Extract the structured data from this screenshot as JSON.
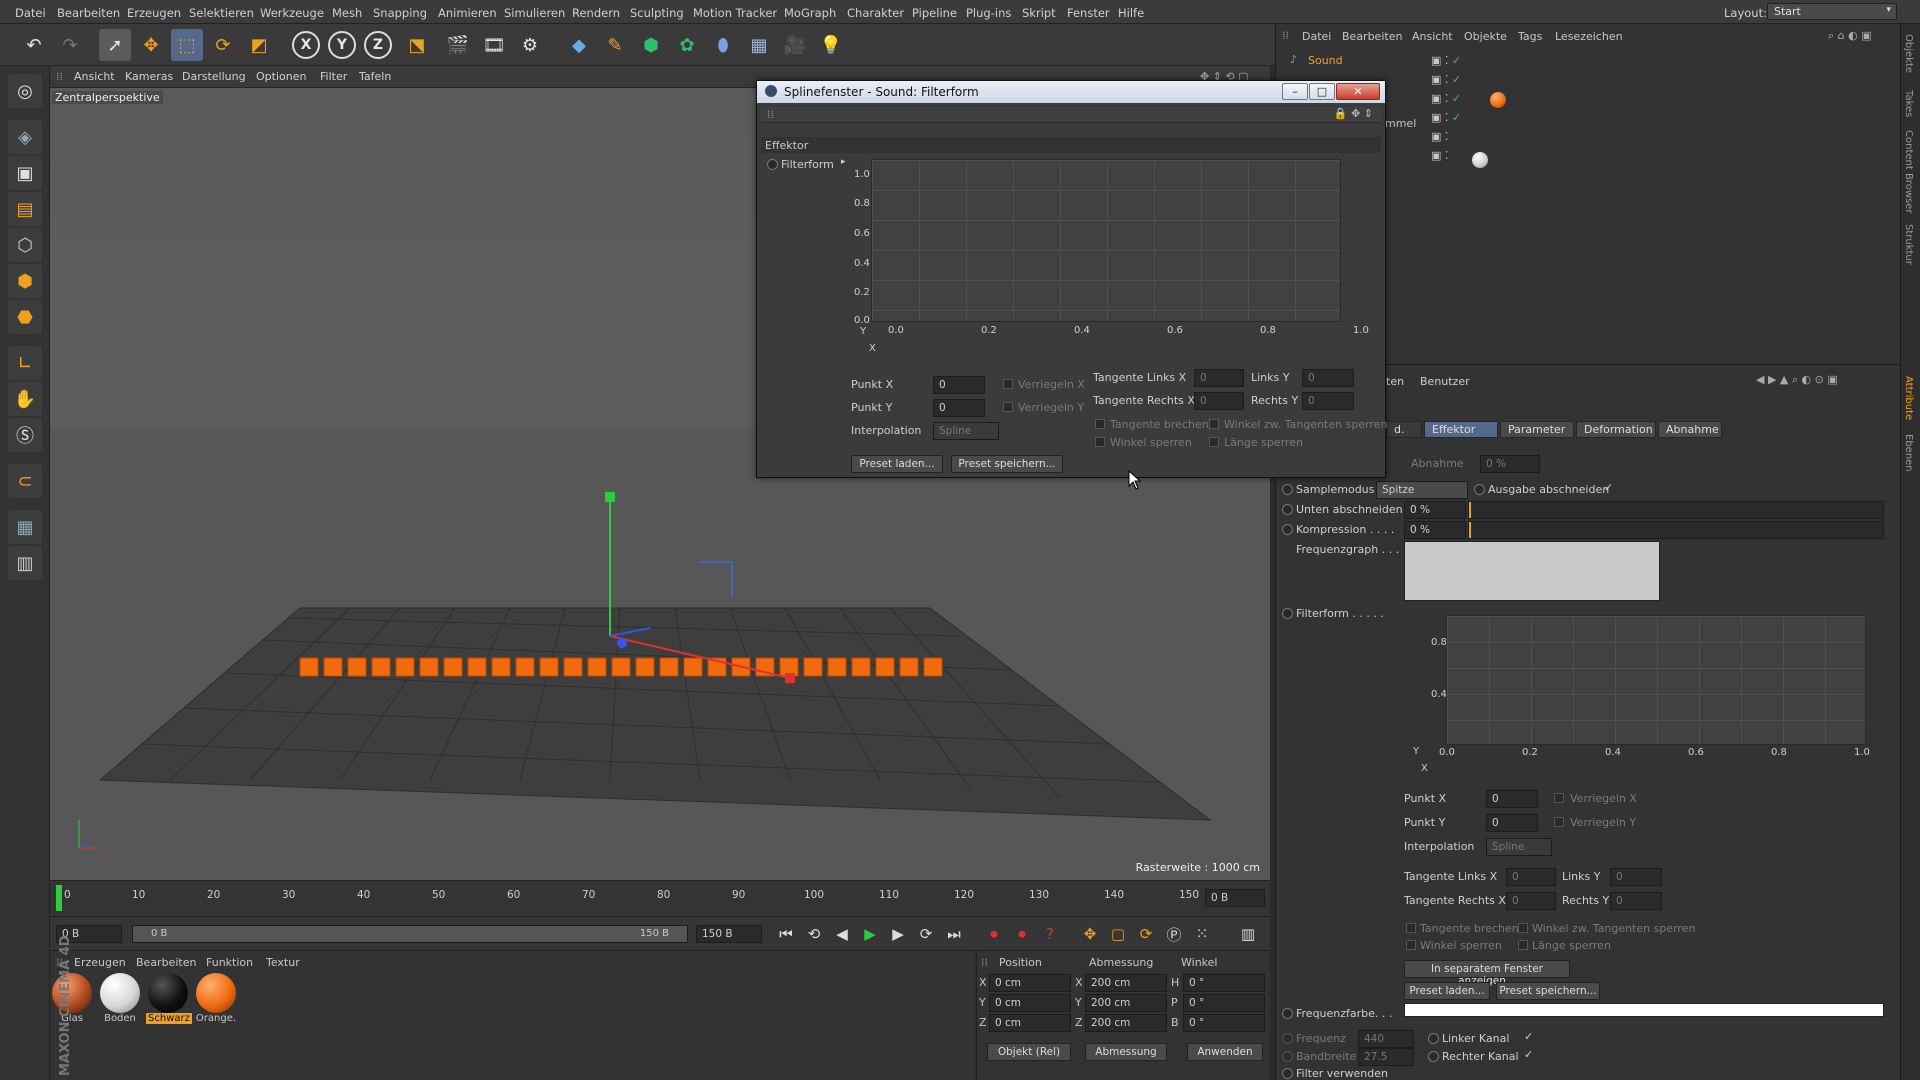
{
  "menu": [
    "Datei",
    "Bearbeiten",
    "Erzeugen",
    "Selektieren",
    "Werkzeuge",
    "Mesh",
    "Snapping",
    "Animieren",
    "Simulieren",
    "Rendern",
    "Sculpting",
    "Motion Tracker",
    "MoGraph",
    "Charakter",
    "Pipeline",
    "Plug-ins",
    "Skript",
    "Fenster",
    "Hilfe"
  ],
  "layout": {
    "label": "Layout:",
    "value": "Start"
  },
  "viewport": {
    "menu": [
      "Ansicht",
      "Kameras",
      "Darstellung",
      "Optionen",
      "Filter",
      "Tafeln"
    ],
    "camera_label": "Zentralperspektive",
    "grid_label": "Rasterweite : 1000 cm"
  },
  "timeline": {
    "ticks": [
      "0",
      "10",
      "20",
      "30",
      "40",
      "50",
      "60",
      "70",
      "80",
      "90",
      "100",
      "110",
      "120",
      "130",
      "140",
      "150"
    ],
    "frame_end": "0 B",
    "cur_frame": "0 B",
    "range_start": "0 B",
    "range_end": "150 B",
    "max_frame": "150 B"
  },
  "materials": {
    "menu": [
      "Erzeugen",
      "Bearbeiten",
      "Funktion",
      "Textur"
    ],
    "items": [
      {
        "name": "Glas",
        "color": "#b04a20"
      },
      {
        "name": "Boden",
        "color": "#e6e6e6"
      },
      {
        "name": "Schwarz",
        "color": "#151515"
      },
      {
        "name": "Orange.",
        "color": "#f06a10"
      }
    ],
    "brand": "MAXON CINEMA 4D"
  },
  "coords": {
    "headers": [
      "Position",
      "Abmessung",
      "Winkel"
    ],
    "rows": [
      {
        "a": "X",
        "pos": "0 cm",
        "b": "X",
        "size": "200 cm",
        "c": "H",
        "rot": "0 °"
      },
      {
        "a": "Y",
        "pos": "0 cm",
        "b": "Y",
        "size": "200 cm",
        "c": "P",
        "rot": "0 °"
      },
      {
        "a": "Z",
        "pos": "0 cm",
        "b": "Z",
        "size": "200 cm",
        "c": "B",
        "rot": "0 °"
      }
    ],
    "mode": "Objekt (Rel)",
    "size_mode": "Abmessung",
    "apply": "Anwenden"
  },
  "objects": {
    "menu": [
      "Datei",
      "Bearbeiten",
      "Ansicht",
      "Objekte",
      "Tags",
      "Lesezeichen"
    ],
    "first": "Sound",
    "partial": "mmel"
  },
  "attributes": {
    "partial_tab": "ten",
    "user": "Benutzer",
    "tabs": [
      "d.",
      "Effektor",
      "Parameter",
      "Deformation",
      "Abnahme"
    ],
    "abnahme": {
      "label": "Abnahme",
      "value": "0 %"
    },
    "samplemodus": {
      "label": "Samplemodus",
      "value": "Spitze"
    },
    "ausgabe": "Ausgabe abschneiden",
    "unten": {
      "label": "Unten abschneiden",
      "value": "0 %"
    },
    "kompression": {
      "label": "Kompression . . . .",
      "value": "0 %"
    },
    "frequenzgraph": "Frequenzgraph . . .",
    "filterform": "Filterform . . . . .",
    "graph_y": [
      "0.8",
      "0.4"
    ],
    "graph_x": [
      "0.0",
      "0.2",
      "0.4",
      "0.6",
      "0.8",
      "1.0"
    ],
    "y": "Y",
    "x": "X",
    "punkt_x": {
      "label": "Punkt X",
      "value": "0"
    },
    "punkt_y": {
      "label": "Punkt Y",
      "value": "0"
    },
    "verriegeln_x": "Verriegeln X",
    "verriegeln_y": "Verriegeln Y",
    "interpolation": {
      "label": "Interpolation",
      "value": "Spline"
    },
    "tan_links_x": {
      "label": "Tangente Links X",
      "value": "0"
    },
    "links_y": {
      "label": "Links Y",
      "value": "0"
    },
    "tan_rechts_x": {
      "label": "Tangente Rechts X",
      "value": "0"
    },
    "rechts_y": {
      "label": "Rechts Y",
      "value": "0"
    },
    "tangente_brechen": "Tangente brechen",
    "winkel_zw": "Winkel zw. Tangenten sperren",
    "winkel_sperren": "Winkel sperren",
    "laenge_sperren": "Länge sperren",
    "separate": "In separatem Fenster anzeigen...",
    "preset_load": "Preset laden...",
    "preset_save": "Preset speichern...",
    "frequenzfarbe": "Frequenzfarbe. . .",
    "frequenz": {
      "label": "Frequenz",
      "value": "440"
    },
    "bandbreite": {
      "label": "Bandbreite",
      "value": "27.5"
    },
    "linker": "Linker Kanal",
    "rechter": "Rechter Kanal",
    "filter": "Filter verwenden"
  },
  "dialog": {
    "title": "Splinefenster - Sound: Filterform",
    "section": "Effektor",
    "item": "Filterform",
    "y_ticks": [
      "1.0",
      "0.8",
      "0.6",
      "0.4",
      "0.2",
      "0.0"
    ],
    "x_ticks": [
      "0.0",
      "0.2",
      "0.4",
      "0.6",
      "0.8",
      "1.0"
    ],
    "y": "Y",
    "x": "X",
    "punkt_x": {
      "label": "Punkt X",
      "value": "0"
    },
    "punkt_y": {
      "label": "Punkt Y",
      "value": "0"
    },
    "verriegeln_x": "Verriegeln X",
    "verriegeln_y": "Verriegeln Y",
    "interpolation": {
      "label": "Interpolation",
      "value": "Spline"
    },
    "tan_links_x": {
      "label": "Tangente Links X",
      "value": "0"
    },
    "links_y": {
      "label": "Links Y",
      "value": "0"
    },
    "tan_rechts_x": {
      "label": "Tangente Rechts X",
      "value": "0"
    },
    "rechts_y": {
      "label": "Rechts Y",
      "value": "0"
    },
    "tangente_brechen": "Tangente brechen",
    "winkel_zw": "Winkel zw. Tangenten sperren",
    "winkel_sperren": "Winkel sperren",
    "laenge_sperren": "Länge sperren",
    "preset_load": "Preset laden...",
    "preset_save": "Preset speichern..."
  },
  "sidetabs": [
    "Objekte",
    "Takes",
    "Content Browser",
    "Struktur",
    "Attribute",
    "Ebenen"
  ]
}
